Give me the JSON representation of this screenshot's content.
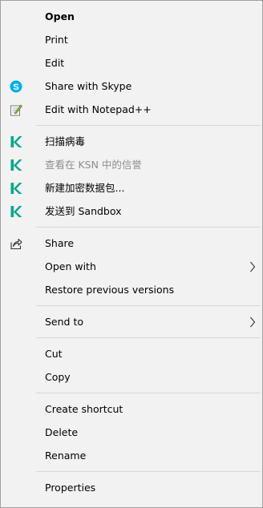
{
  "menu": {
    "open": "Open",
    "print": "Print",
    "edit": "Edit",
    "share_skype": "Share with Skype",
    "edit_notepad": "Edit with Notepad++",
    "kaspersky_scan": "扫描病毒",
    "kaspersky_ksn": "查看在 KSN 中的信誉",
    "kaspersky_archive": "新建加密数据包...",
    "kaspersky_sandbox": "发送到 Sandbox",
    "share": "Share",
    "open_with": "Open with",
    "restore_versions": "Restore previous versions",
    "send_to": "Send to",
    "cut": "Cut",
    "copy": "Copy",
    "create_shortcut": "Create shortcut",
    "delete": "Delete",
    "rename": "Rename",
    "properties": "Properties"
  },
  "colors": {
    "skype_blue": "#00aff0",
    "kaspersky_green": "#00a88e",
    "disabled_text": "#8d8d8d"
  },
  "icons": {
    "skype": "skype-icon",
    "notepad": "notepad-plus-plus-icon",
    "kaspersky": "kaspersky-k-icon",
    "share": "share-arrow-icon",
    "submenu": "chevron-right-icon"
  }
}
